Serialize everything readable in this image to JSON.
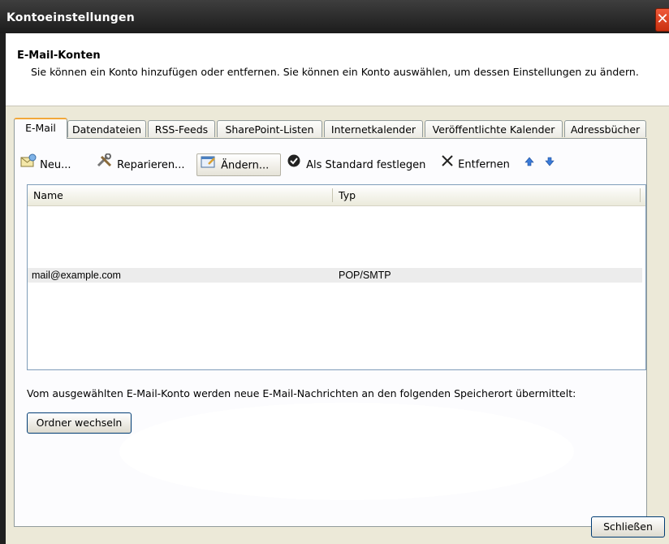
{
  "window": {
    "title": "Kontoeinstellungen",
    "close_glyph": "✕"
  },
  "header": {
    "title": "E-Mail-Konten",
    "description": "Sie können ein Konto hinzufügen oder entfernen. Sie können ein Konto auswählen, um dessen Einstellungen zu ändern."
  },
  "tabs": [
    {
      "label": "E-Mail",
      "active": true
    },
    {
      "label": "Datendateien",
      "active": false
    },
    {
      "label": "RSS-Feeds",
      "active": false
    },
    {
      "label": "SharePoint-Listen",
      "active": false
    },
    {
      "label": "Internetkalender",
      "active": false
    },
    {
      "label": "Veröffentlichte Kalender",
      "active": false
    },
    {
      "label": "Adressbücher",
      "active": false
    }
  ],
  "toolbar": {
    "new_label": "Neu...",
    "repair_label": "Reparieren...",
    "change_label": "Ändern...",
    "default_label": "Als Standard festlegen",
    "remove_label": "Entfernen",
    "up_icon": "arrow-up-icon",
    "down_icon": "arrow-down-icon"
  },
  "accounts_table": {
    "columns": [
      "Name",
      "Typ"
    ],
    "rows": [
      {
        "name": "mail@example.com",
        "type": "POP/SMTP"
      }
    ]
  },
  "delivery": {
    "text": "Vom ausgewählten E-Mail-Konto werden neue E-Mail-Nachrichten an den folgenden Speicherort übermittelt:",
    "change_folder_label": "Ordner wechseln"
  },
  "footer": {
    "close_label": "Schließen"
  },
  "colors": {
    "titlebar": "#2e2e2e",
    "dialog_bg": "#ece9d8",
    "active_tab_accent": "#f2a83a",
    "close_button": "#e0441c"
  }
}
